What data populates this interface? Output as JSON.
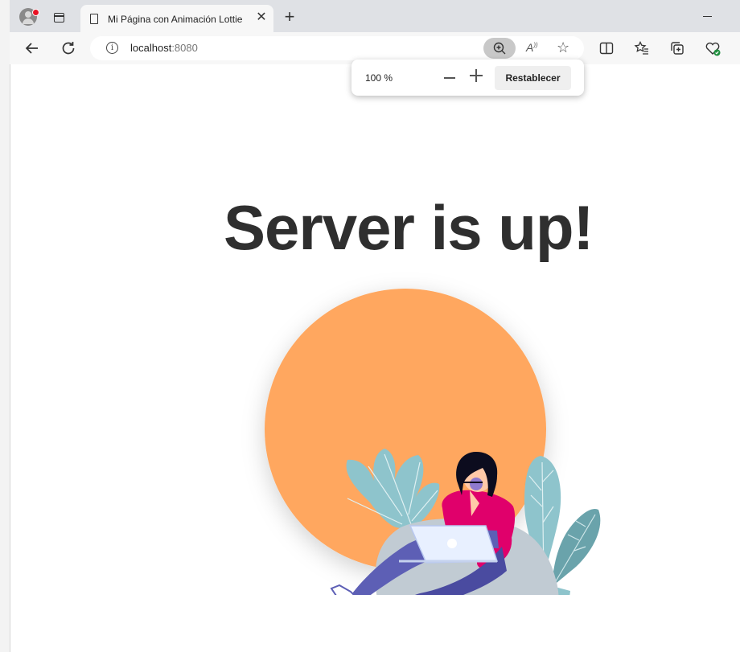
{
  "browser": {
    "tab": {
      "title": "Mi Página con Animación Lottie"
    },
    "address": {
      "host": "localhost",
      "port": ":8080"
    }
  },
  "zoom_popup": {
    "level": "100 %",
    "reset_label": "Restablecer"
  },
  "page": {
    "heading": "Server is up!"
  },
  "colors": {
    "circle": "#ffa75f",
    "accent": "#e0006b",
    "tabstrip": "#dfe1e5"
  }
}
